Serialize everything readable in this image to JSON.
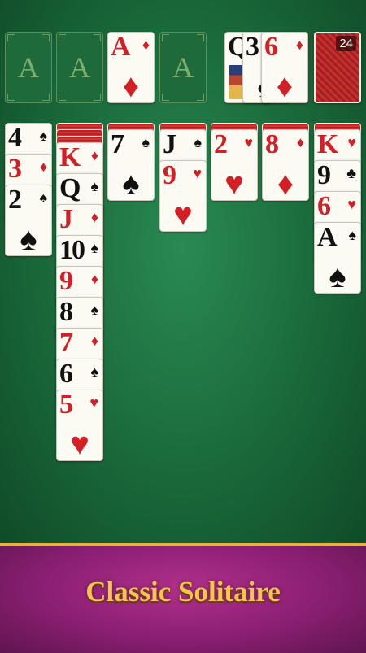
{
  "foundations": [
    {
      "placeholder": "A"
    },
    {
      "placeholder": "A"
    },
    {
      "rank": "A",
      "suit": "♦",
      "color": "red"
    },
    {
      "placeholder": "A"
    }
  ],
  "waste": [
    {
      "rank": "Q",
      "suit": "♠",
      "color": "black"
    },
    {
      "rank": "3",
      "suit": "♠",
      "color": "black"
    },
    {
      "rank": "6",
      "suit": "♦",
      "color": "red"
    }
  ],
  "stock": {
    "count": "24"
  },
  "tableau": [
    {
      "hidden": 0,
      "cards": [
        {
          "rank": "4",
          "suit": "♠",
          "color": "black"
        },
        {
          "rank": "3",
          "suit": "♦",
          "color": "red"
        },
        {
          "rank": "2",
          "suit": "♠",
          "color": "black"
        }
      ]
    },
    {
      "hidden": 3,
      "cards": [
        {
          "rank": "K",
          "suit": "♦",
          "color": "red"
        },
        {
          "rank": "Q",
          "suit": "♠",
          "color": "black"
        },
        {
          "rank": "J",
          "suit": "♦",
          "color": "red"
        },
        {
          "rank": "10",
          "suit": "♠",
          "color": "black"
        },
        {
          "rank": "9",
          "suit": "♦",
          "color": "red"
        },
        {
          "rank": "8",
          "suit": "♠",
          "color": "black"
        },
        {
          "rank": "7",
          "suit": "♦",
          "color": "red"
        },
        {
          "rank": "6",
          "suit": "♠",
          "color": "black"
        },
        {
          "rank": "5",
          "suit": "♥",
          "color": "red"
        }
      ]
    },
    {
      "hidden": 1,
      "cards": [
        {
          "rank": "7",
          "suit": "♠",
          "color": "black"
        }
      ]
    },
    {
      "hidden": 1,
      "cards": [
        {
          "rank": "J",
          "suit": "♠",
          "color": "black"
        },
        {
          "rank": "9",
          "suit": "♥",
          "color": "red"
        }
      ]
    },
    {
      "hidden": 1,
      "cards": [
        {
          "rank": "2",
          "suit": "♥",
          "color": "red"
        }
      ]
    },
    {
      "hidden": 1,
      "cards": [
        {
          "rank": "8",
          "suit": "♦",
          "color": "red"
        }
      ]
    },
    {
      "hidden": 1,
      "cards": [
        {
          "rank": "K",
          "suit": "♥",
          "color": "red"
        },
        {
          "rank": "9",
          "suit": "♣",
          "color": "black"
        },
        {
          "rank": "6",
          "suit": "♥",
          "color": "red"
        },
        {
          "rank": "A",
          "suit": "♠",
          "color": "black"
        }
      ]
    }
  ],
  "banner": {
    "title": "Classic Solitaire"
  },
  "colors": {
    "felt": "#1c6e3e",
    "banner": "#8a1f72",
    "title_gold": "#f6c64a",
    "red_suit": "#d31f26"
  }
}
